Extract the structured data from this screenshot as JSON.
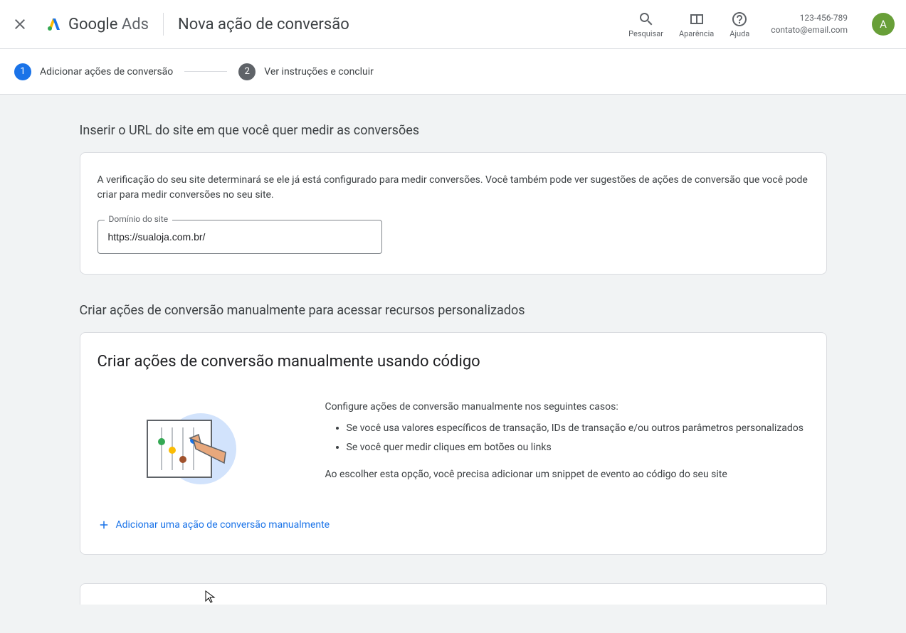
{
  "header": {
    "logo_text_1": "Google",
    "logo_text_2": "Ads",
    "page_title": "Nova ação de conversão",
    "tools": {
      "search": "Pesquisar",
      "appearance": "Aparência",
      "help": "Ajuda"
    },
    "account_id": "123-456-789",
    "account_email": "contato@email.com",
    "avatar_letter": "A"
  },
  "stepper": {
    "step1_num": "1",
    "step1_label": "Adicionar ações de conversão",
    "step2_num": "2",
    "step2_label": "Ver instruções e concluir"
  },
  "section1": {
    "title": "Inserir o URL do site em que você quer medir as conversões",
    "description": "A verificação do seu site determinará se ele já está configurado para medir conversões. Você também pode ver sugestões de ações de conversão que você pode criar para medir conversões no seu site.",
    "input_label": "Domínio do site",
    "input_value": "https://sualoja.com.br/"
  },
  "section2": {
    "title": "Criar ações de conversão manualmente para acessar recursos personalizados",
    "card_title": "Criar ações de conversão manualmente usando código",
    "intro": "Configure ações de conversão manualmente nos seguintes casos:",
    "bullet1": "Se você usa valores específicos de transação, IDs de transação e/ou outros parâmetros personalizados",
    "bullet2": "Se você quer medir cliques em botões ou links",
    "footer": "Ao escolher esta opção, você precisa adicionar um snippet de evento ao código do seu site",
    "add_link": "Adicionar uma ação de conversão manualmente"
  }
}
